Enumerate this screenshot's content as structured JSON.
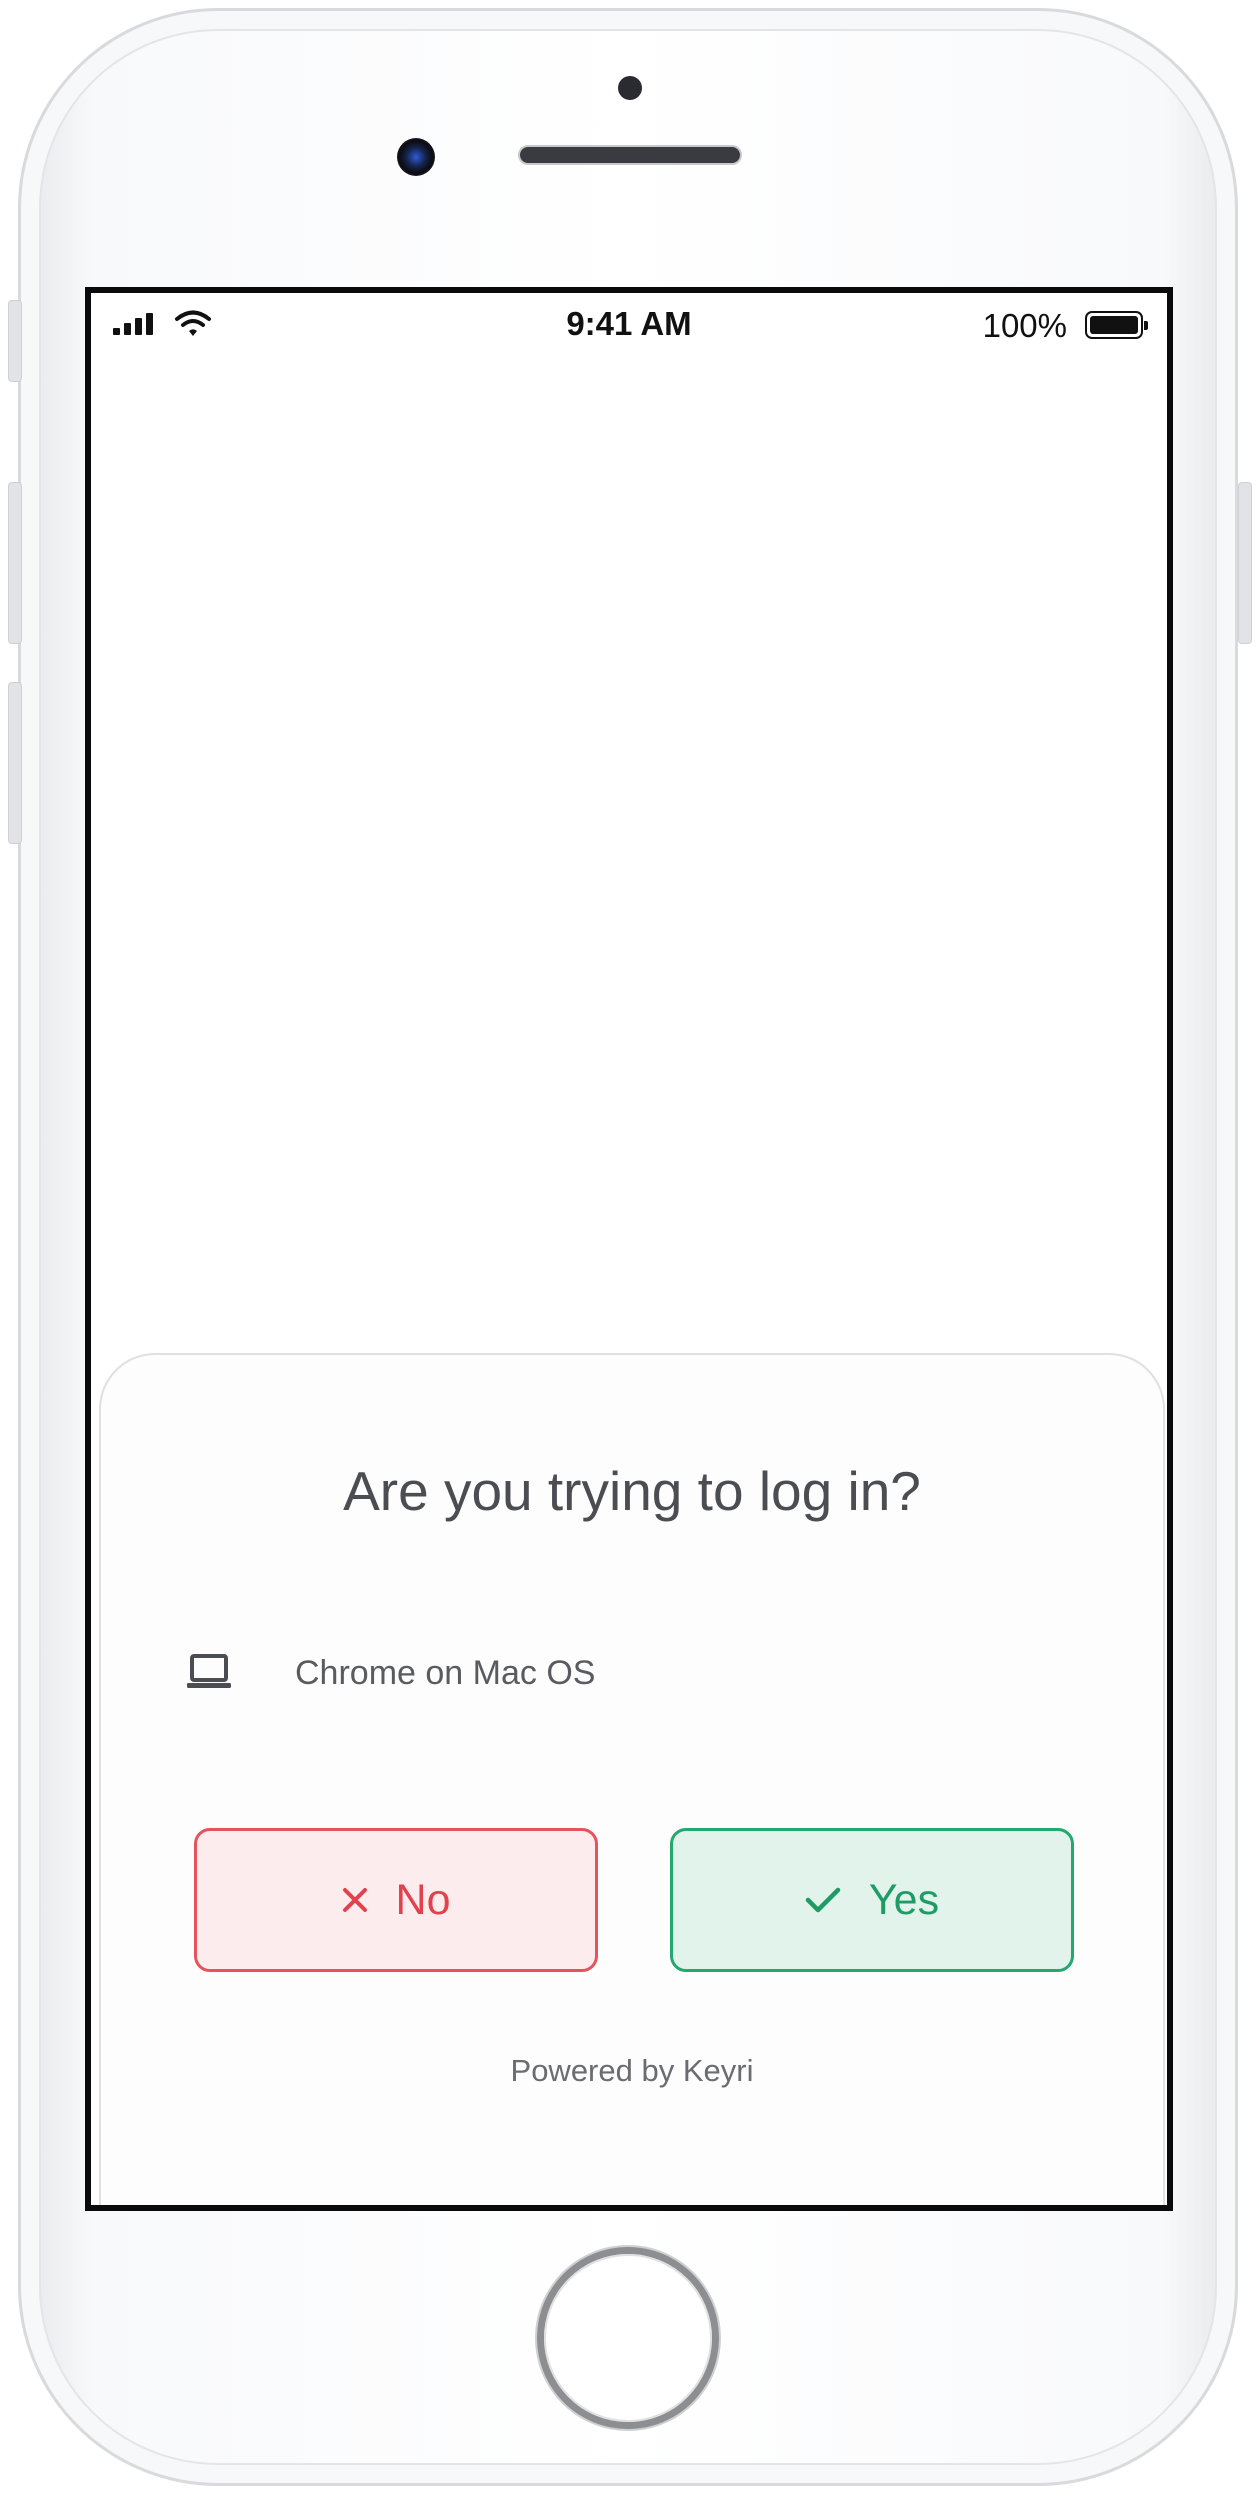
{
  "status_bar": {
    "time": "9:41 AM",
    "battery_percent": "100%",
    "battery_level": 1.0
  },
  "prompt": {
    "title": "Are you trying to log in?",
    "device": {
      "icon": "laptop-icon",
      "label": "Chrome on Mac OS"
    },
    "buttons": {
      "no_label": "No",
      "no_icon": "close-icon",
      "yes_label": "Yes",
      "yes_icon": "check-icon"
    },
    "footer": "Powered by Keyri"
  },
  "colors": {
    "no_border": "#e5535d",
    "no_background": "#fdecee",
    "yes_border": "#23a870",
    "yes_background": "#e2f3ec"
  }
}
